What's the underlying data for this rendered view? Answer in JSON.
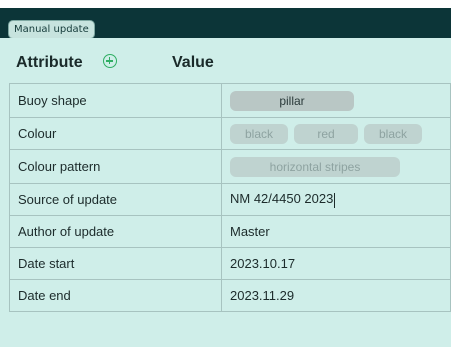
{
  "mode_tab": "Manual update",
  "header": {
    "attribute": "Attribute",
    "value": "Value"
  },
  "rows": [
    {
      "name": "Buoy shape",
      "chips": [
        "pillar"
      ]
    },
    {
      "name": "Colour",
      "chips": [
        "black",
        "red",
        "black"
      ]
    },
    {
      "name": "Colour pattern",
      "chips": [
        "horizontal stripes"
      ]
    },
    {
      "name": "Source of update",
      "value": "NM 42/4450 2023"
    },
    {
      "name": "Author of update",
      "value": "Master"
    },
    {
      "name": "Date start",
      "value": "2023.10.17"
    },
    {
      "name": "Date end",
      "value": "2023.11.29"
    }
  ],
  "colors": {
    "accent": "#2fae63",
    "panel": "#cfeee9",
    "topbar": "#0c3538"
  }
}
